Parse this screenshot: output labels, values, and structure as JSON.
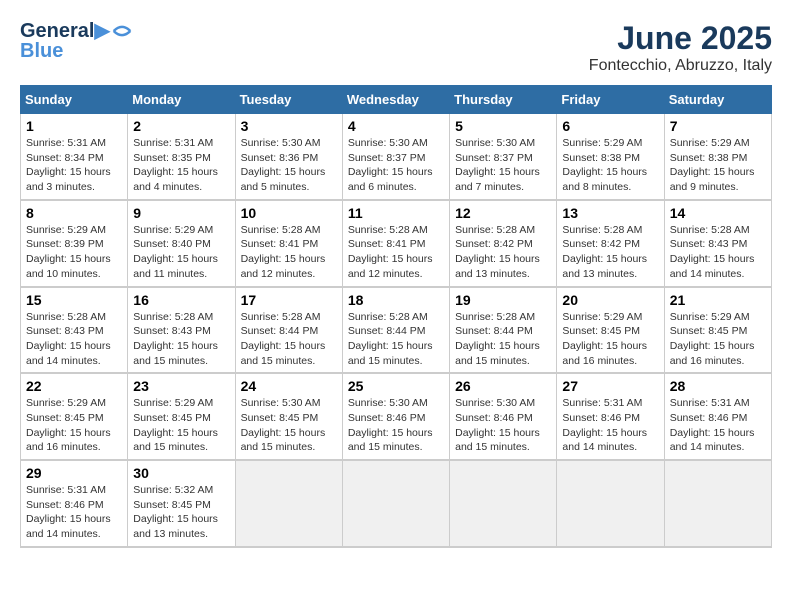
{
  "header": {
    "logo_line1": "General",
    "logo_line2": "Blue",
    "title": "June 2025",
    "subtitle": "Fontecchio, Abruzzo, Italy"
  },
  "calendar": {
    "days_of_week": [
      "Sunday",
      "Monday",
      "Tuesday",
      "Wednesday",
      "Thursday",
      "Friday",
      "Saturday"
    ],
    "weeks": [
      [
        {
          "day": "1",
          "sunrise": "Sunrise: 5:31 AM",
          "sunset": "Sunset: 8:34 PM",
          "daylight": "Daylight: 15 hours and 3 minutes."
        },
        {
          "day": "2",
          "sunrise": "Sunrise: 5:31 AM",
          "sunset": "Sunset: 8:35 PM",
          "daylight": "Daylight: 15 hours and 4 minutes."
        },
        {
          "day": "3",
          "sunrise": "Sunrise: 5:30 AM",
          "sunset": "Sunset: 8:36 PM",
          "daylight": "Daylight: 15 hours and 5 minutes."
        },
        {
          "day": "4",
          "sunrise": "Sunrise: 5:30 AM",
          "sunset": "Sunset: 8:37 PM",
          "daylight": "Daylight: 15 hours and 6 minutes."
        },
        {
          "day": "5",
          "sunrise": "Sunrise: 5:30 AM",
          "sunset": "Sunset: 8:37 PM",
          "daylight": "Daylight: 15 hours and 7 minutes."
        },
        {
          "day": "6",
          "sunrise": "Sunrise: 5:29 AM",
          "sunset": "Sunset: 8:38 PM",
          "daylight": "Daylight: 15 hours and 8 minutes."
        },
        {
          "day": "7",
          "sunrise": "Sunrise: 5:29 AM",
          "sunset": "Sunset: 8:38 PM",
          "daylight": "Daylight: 15 hours and 9 minutes."
        }
      ],
      [
        {
          "day": "8",
          "sunrise": "Sunrise: 5:29 AM",
          "sunset": "Sunset: 8:39 PM",
          "daylight": "Daylight: 15 hours and 10 minutes."
        },
        {
          "day": "9",
          "sunrise": "Sunrise: 5:29 AM",
          "sunset": "Sunset: 8:40 PM",
          "daylight": "Daylight: 15 hours and 11 minutes."
        },
        {
          "day": "10",
          "sunrise": "Sunrise: 5:28 AM",
          "sunset": "Sunset: 8:41 PM",
          "daylight": "Daylight: 15 hours and 12 minutes."
        },
        {
          "day": "11",
          "sunrise": "Sunrise: 5:28 AM",
          "sunset": "Sunset: 8:41 PM",
          "daylight": "Daylight: 15 hours and 12 minutes."
        },
        {
          "day": "12",
          "sunrise": "Sunrise: 5:28 AM",
          "sunset": "Sunset: 8:42 PM",
          "daylight": "Daylight: 15 hours and 13 minutes."
        },
        {
          "day": "13",
          "sunrise": "Sunrise: 5:28 AM",
          "sunset": "Sunset: 8:42 PM",
          "daylight": "Daylight: 15 hours and 13 minutes."
        },
        {
          "day": "14",
          "sunrise": "Sunrise: 5:28 AM",
          "sunset": "Sunset: 8:43 PM",
          "daylight": "Daylight: 15 hours and 14 minutes."
        }
      ],
      [
        {
          "day": "15",
          "sunrise": "Sunrise: 5:28 AM",
          "sunset": "Sunset: 8:43 PM",
          "daylight": "Daylight: 15 hours and 14 minutes."
        },
        {
          "day": "16",
          "sunrise": "Sunrise: 5:28 AM",
          "sunset": "Sunset: 8:43 PM",
          "daylight": "Daylight: 15 hours and 15 minutes."
        },
        {
          "day": "17",
          "sunrise": "Sunrise: 5:28 AM",
          "sunset": "Sunset: 8:44 PM",
          "daylight": "Daylight: 15 hours and 15 minutes."
        },
        {
          "day": "18",
          "sunrise": "Sunrise: 5:28 AM",
          "sunset": "Sunset: 8:44 PM",
          "daylight": "Daylight: 15 hours and 15 minutes."
        },
        {
          "day": "19",
          "sunrise": "Sunrise: 5:28 AM",
          "sunset": "Sunset: 8:44 PM",
          "daylight": "Daylight: 15 hours and 15 minutes."
        },
        {
          "day": "20",
          "sunrise": "Sunrise: 5:29 AM",
          "sunset": "Sunset: 8:45 PM",
          "daylight": "Daylight: 15 hours and 16 minutes."
        },
        {
          "day": "21",
          "sunrise": "Sunrise: 5:29 AM",
          "sunset": "Sunset: 8:45 PM",
          "daylight": "Daylight: 15 hours and 16 minutes."
        }
      ],
      [
        {
          "day": "22",
          "sunrise": "Sunrise: 5:29 AM",
          "sunset": "Sunset: 8:45 PM",
          "daylight": "Daylight: 15 hours and 16 minutes."
        },
        {
          "day": "23",
          "sunrise": "Sunrise: 5:29 AM",
          "sunset": "Sunset: 8:45 PM",
          "daylight": "Daylight: 15 hours and 15 minutes."
        },
        {
          "day": "24",
          "sunrise": "Sunrise: 5:30 AM",
          "sunset": "Sunset: 8:45 PM",
          "daylight": "Daylight: 15 hours and 15 minutes."
        },
        {
          "day": "25",
          "sunrise": "Sunrise: 5:30 AM",
          "sunset": "Sunset: 8:46 PM",
          "daylight": "Daylight: 15 hours and 15 minutes."
        },
        {
          "day": "26",
          "sunrise": "Sunrise: 5:30 AM",
          "sunset": "Sunset: 8:46 PM",
          "daylight": "Daylight: 15 hours and 15 minutes."
        },
        {
          "day": "27",
          "sunrise": "Sunrise: 5:31 AM",
          "sunset": "Sunset: 8:46 PM",
          "daylight": "Daylight: 15 hours and 14 minutes."
        },
        {
          "day": "28",
          "sunrise": "Sunrise: 5:31 AM",
          "sunset": "Sunset: 8:46 PM",
          "daylight": "Daylight: 15 hours and 14 minutes."
        }
      ],
      [
        {
          "day": "29",
          "sunrise": "Sunrise: 5:31 AM",
          "sunset": "Sunset: 8:46 PM",
          "daylight": "Daylight: 15 hours and 14 minutes."
        },
        {
          "day": "30",
          "sunrise": "Sunrise: 5:32 AM",
          "sunset": "Sunset: 8:45 PM",
          "daylight": "Daylight: 15 hours and 13 minutes."
        },
        null,
        null,
        null,
        null,
        null
      ]
    ]
  }
}
